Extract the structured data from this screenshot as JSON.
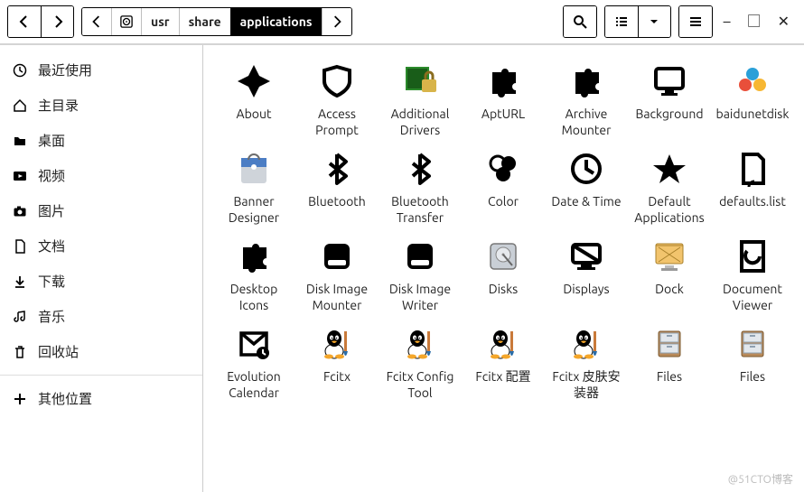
{
  "path": {
    "segments": [
      "usr",
      "share",
      "applications"
    ],
    "activeIndex": 2
  },
  "sidebar": {
    "items": [
      {
        "icon": "clock-icon",
        "label": "最近使用"
      },
      {
        "icon": "home-icon",
        "label": "主目录"
      },
      {
        "icon": "folder-icon",
        "label": "桌面"
      },
      {
        "icon": "video-icon",
        "label": "视频"
      },
      {
        "icon": "camera-icon",
        "label": "图片"
      },
      {
        "icon": "file-icon",
        "label": "文档"
      },
      {
        "icon": "download-icon",
        "label": "下载"
      },
      {
        "icon": "music-icon",
        "label": "音乐"
      },
      {
        "icon": "trash-icon",
        "label": "回收站"
      }
    ],
    "other": {
      "icon": "plus-icon",
      "label": "其他位置"
    }
  },
  "apps": [
    {
      "icon": "spark",
      "label": "About"
    },
    {
      "icon": "shield",
      "label": "Access Prompt"
    },
    {
      "icon": "chip-lock",
      "label": "Additional Drivers"
    },
    {
      "icon": "puzzle",
      "label": "AptURL"
    },
    {
      "icon": "puzzle",
      "label": "Archive Mounter"
    },
    {
      "icon": "monitor",
      "label": "Background"
    },
    {
      "icon": "cloud-color",
      "label": "baidunetdisk"
    },
    {
      "icon": "bag",
      "label": "Banner Designer"
    },
    {
      "icon": "bluetooth",
      "label": "Bluetooth"
    },
    {
      "icon": "bluetooth",
      "label": "Bluetooth Transfer"
    },
    {
      "icon": "circles",
      "label": "Color"
    },
    {
      "icon": "clockbig",
      "label": "Date & Time"
    },
    {
      "icon": "star",
      "label": "Default Applications"
    },
    {
      "icon": "page",
      "label": "defaults.list"
    },
    {
      "icon": "puzzle",
      "label": "Desktop Icons"
    },
    {
      "icon": "disk",
      "label": "Disk Image Mounter"
    },
    {
      "icon": "disk",
      "label": "Disk Image Writer"
    },
    {
      "icon": "hdd",
      "label": "Disks"
    },
    {
      "icon": "display",
      "label": "Displays"
    },
    {
      "icon": "dock-icon",
      "label": "Dock"
    },
    {
      "icon": "doc-e",
      "label": "Document Viewer"
    },
    {
      "icon": "envelope",
      "label": "Evolution Calendar"
    },
    {
      "icon": "tux-brush",
      "label": "Fcitx"
    },
    {
      "icon": "tux-brush",
      "label": "Fcitx Config Tool"
    },
    {
      "icon": "tux-brush",
      "label": "Fcitx 配置"
    },
    {
      "icon": "tux-brush",
      "label": "Fcitx 皮肤安装器"
    },
    {
      "icon": "cabinet",
      "label": "Files"
    },
    {
      "icon": "cabinet",
      "label": "Files"
    }
  ],
  "watermark": "@51CTO博客"
}
